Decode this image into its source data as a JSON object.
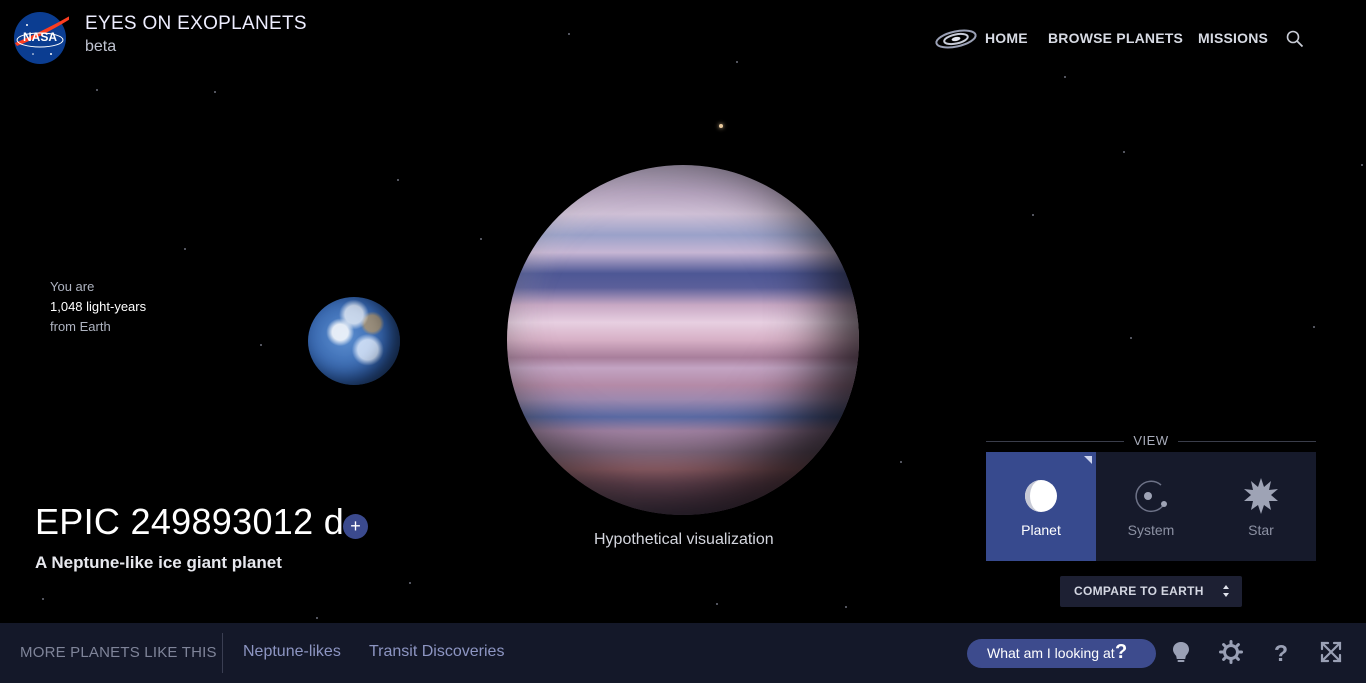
{
  "header": {
    "logo_text": "NASA",
    "title": "EYES ON EXOPLANETS",
    "subtitle": "beta"
  },
  "nav": {
    "items": [
      {
        "label": "HOME",
        "icon": "galaxy-icon"
      },
      {
        "label": "BROWSE PLANETS"
      },
      {
        "label": "MISSIONS"
      }
    ],
    "search_icon": "search-icon"
  },
  "distance": {
    "line1": "You are",
    "line2": "1,048 light-years",
    "line3": "from Earth"
  },
  "planet": {
    "name": "EPIC 249893012 d",
    "add_label": "+",
    "type": "A Neptune-like ice giant planet",
    "visual_caption": "Hypothetical visualization"
  },
  "view": {
    "label": "VIEW",
    "options": [
      {
        "label": "Planet",
        "icon": "planet-icon",
        "active": true
      },
      {
        "label": "System",
        "icon": "system-icon",
        "active": false
      },
      {
        "label": "Star",
        "icon": "star-icon",
        "active": false
      }
    ],
    "compare_label": "COMPARE TO EARTH"
  },
  "footer": {
    "more_label": "MORE PLANETS LIKE THIS",
    "links": [
      "Neptune-likes",
      "Transit Discoveries"
    ],
    "what_label": "What am I looking at",
    "what_icon": "question-icon",
    "tools": [
      "lightbulb-icon",
      "gear-icon",
      "help-icon",
      "fullscreen-icon"
    ]
  },
  "colors": {
    "accent": "#374a8e",
    "panel": "#161a2b",
    "footer": "#141829",
    "link": "#8d95c2"
  }
}
